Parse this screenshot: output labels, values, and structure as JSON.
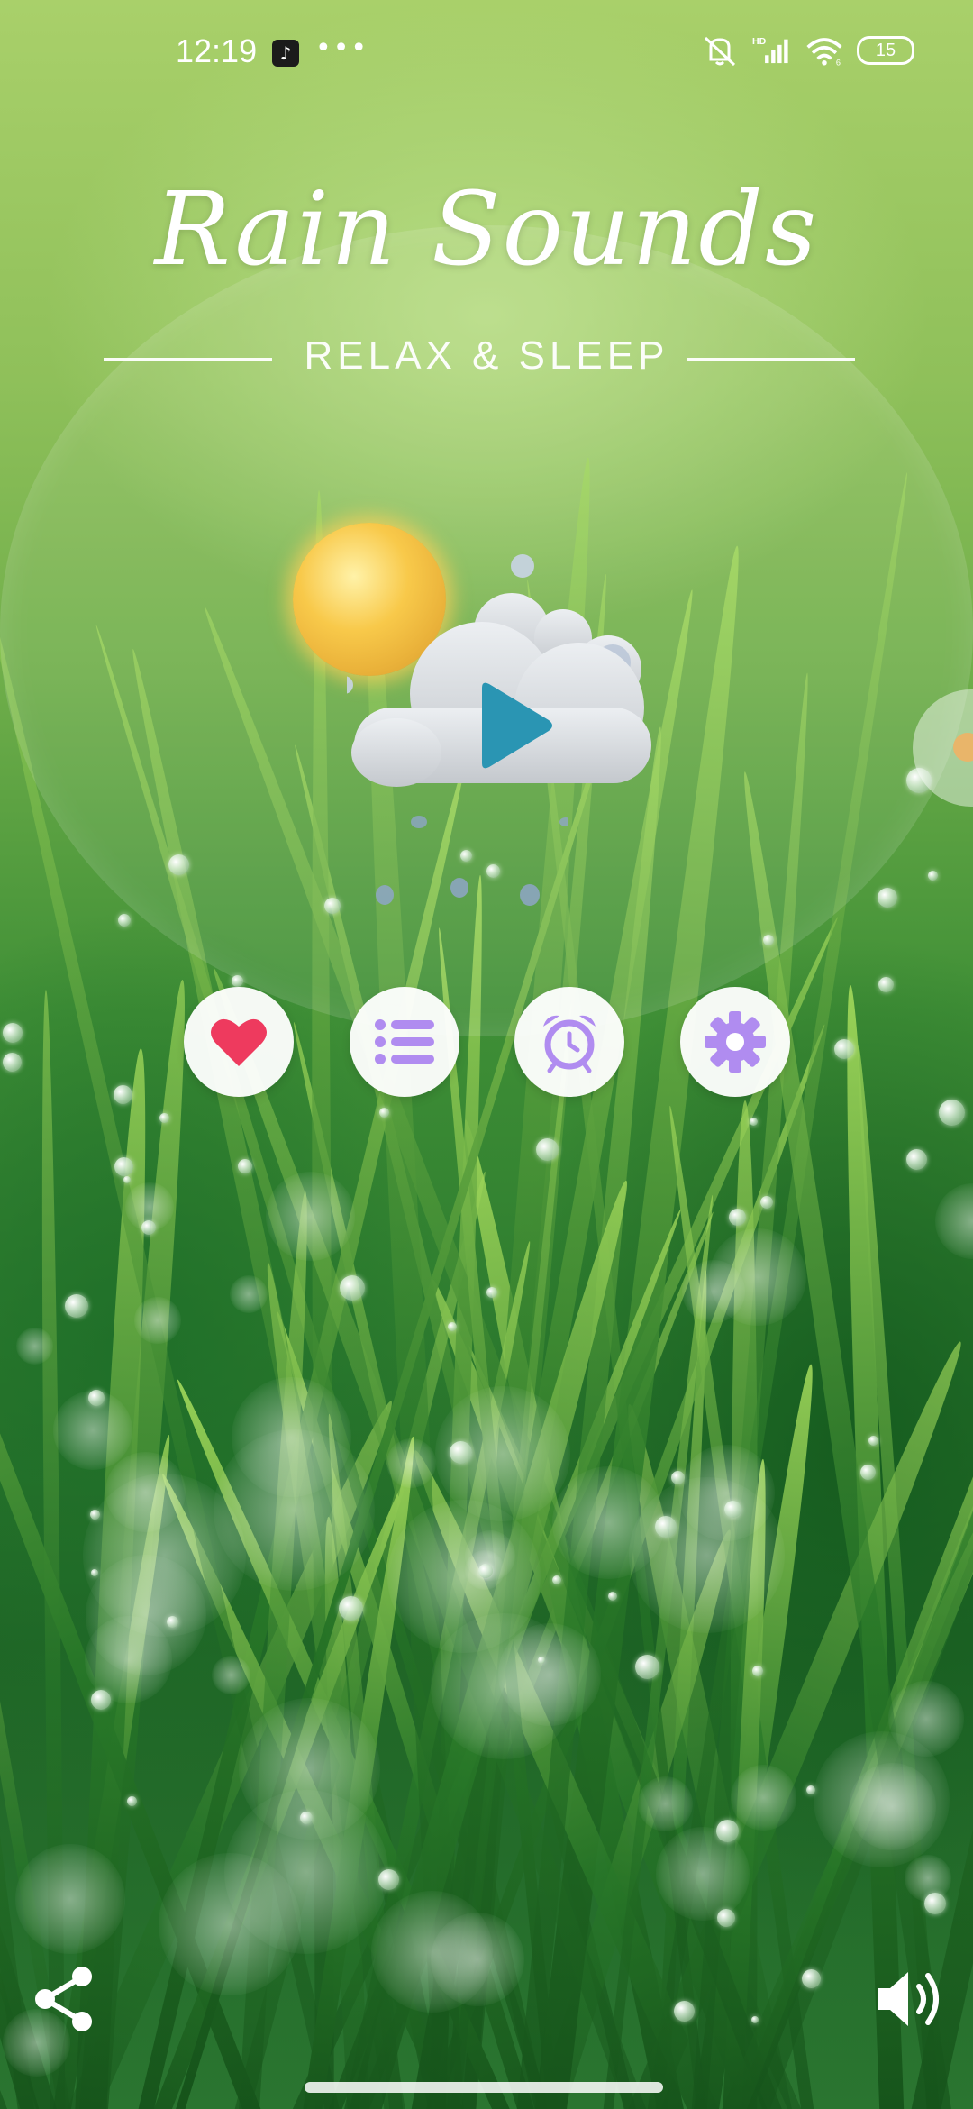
{
  "status_bar": {
    "time": "12:19",
    "tiktok_glyph": "♪",
    "more": "•••",
    "battery": "15",
    "icons": [
      "mute-icon",
      "hd-signal-icon",
      "wifi-icon",
      "battery-icon"
    ]
  },
  "header": {
    "title": "Rain Sounds",
    "subtitle": "RELAX & SLEEP"
  },
  "player": {
    "play_icon": "play-icon",
    "weather_icons": [
      "sun-icon",
      "cloud-icon",
      "rain-drops"
    ]
  },
  "actions": [
    {
      "name": "favorites",
      "icon": "heart-icon",
      "color": "#ee3a5e"
    },
    {
      "name": "playlist",
      "icon": "list-icon",
      "color": "#b08cf0"
    },
    {
      "name": "alarm",
      "icon": "alarm-clock-icon",
      "color": "#b08cf0"
    },
    {
      "name": "settings",
      "icon": "gear-icon",
      "color": "#b08cf0"
    }
  ],
  "footer": {
    "share_icon": "share-icon",
    "volume_icon": "volume-icon"
  },
  "colors": {
    "accent_purple": "#b08cf0",
    "heart_red": "#ee3a5e",
    "play_teal": "#2a95b3"
  }
}
